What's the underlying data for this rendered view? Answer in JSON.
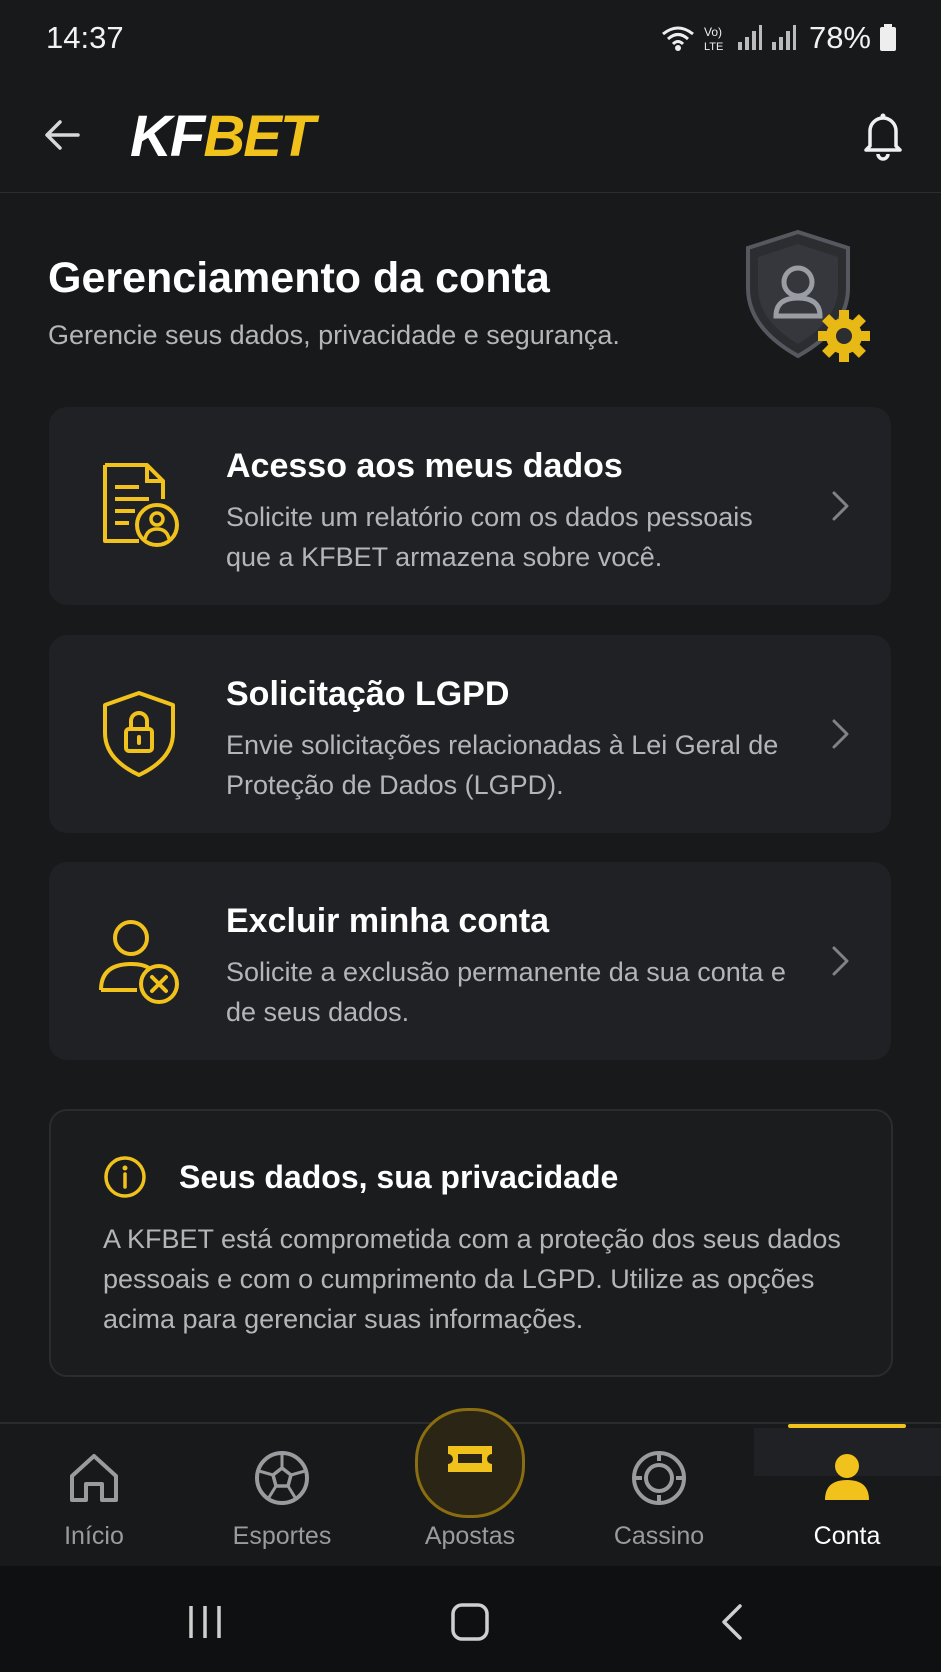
{
  "status_bar": {
    "time": "14:37",
    "network_label": "Vo) LTE",
    "battery": "78%"
  },
  "header": {
    "logo_left": "KF",
    "logo_right": "BET",
    "back_icon": "arrow-left-icon",
    "bell_icon": "bell-icon"
  },
  "page": {
    "title": "Gerenciamento da conta",
    "subtitle": "Gerencie seus dados, privacidade e segurança."
  },
  "cards": [
    {
      "title": "Acesso aos meus dados",
      "description": "Solicite um relatório com os dados pessoais que a KFBET armazena sobre você.",
      "icon": "document-user-icon"
    },
    {
      "title": "Solicitação LGPD",
      "description": "Envie solicitações relacionadas à Lei Geral de Proteção de Dados (LGPD).",
      "icon": "shield-lock-icon"
    },
    {
      "title": "Excluir minha conta",
      "description": "Solicite a exclusão permanente da sua conta e de seus dados.",
      "icon": "user-remove-icon"
    }
  ],
  "info": {
    "title": "Seus dados, sua privacidade",
    "text": "A KFBET está comprometida com a proteção dos seus dados pessoais e com o cumprimento da LGPD. Utilize as opções acima para gerenciar suas informações."
  },
  "nav": {
    "items": [
      {
        "label": "Início",
        "icon": "home-icon"
      },
      {
        "label": "Esportes",
        "icon": "soccer-ball-icon"
      },
      {
        "label": "Apostas",
        "icon": "ticket-icon"
      },
      {
        "label": "Cassino",
        "icon": "casino-chip-icon"
      },
      {
        "label": "Conta",
        "icon": "user-icon"
      }
    ],
    "active": "Conta"
  },
  "colors": {
    "accent": "#f1c21b",
    "background": "#18191b",
    "card": "#202124",
    "muted_text": "#b4b5b8"
  }
}
